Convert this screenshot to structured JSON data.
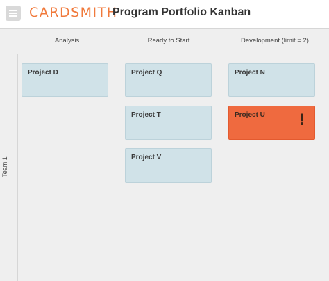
{
  "header": {
    "menu_icon": "hamburger-menu-icon",
    "logo_text": "CARDSMITH",
    "title": "Program Portfolio Kanban"
  },
  "columns": [
    {
      "label": "Analysis"
    },
    {
      "label": "Ready to Start"
    },
    {
      "label": "Development (limit = 2)"
    }
  ],
  "swimlane": {
    "label": "Team 1"
  },
  "cards": {
    "analysis": [
      {
        "title": "Project D"
      }
    ],
    "ready": [
      {
        "title": "Project Q"
      },
      {
        "title": "Project T"
      },
      {
        "title": "Project V"
      }
    ],
    "development": [
      {
        "title": "Project N"
      },
      {
        "title": "Project U",
        "alert": "!"
      }
    ]
  },
  "colors": {
    "brand": "#f07a3c",
    "card": "#d0e2e8",
    "alert_card": "#ef6a3f"
  }
}
